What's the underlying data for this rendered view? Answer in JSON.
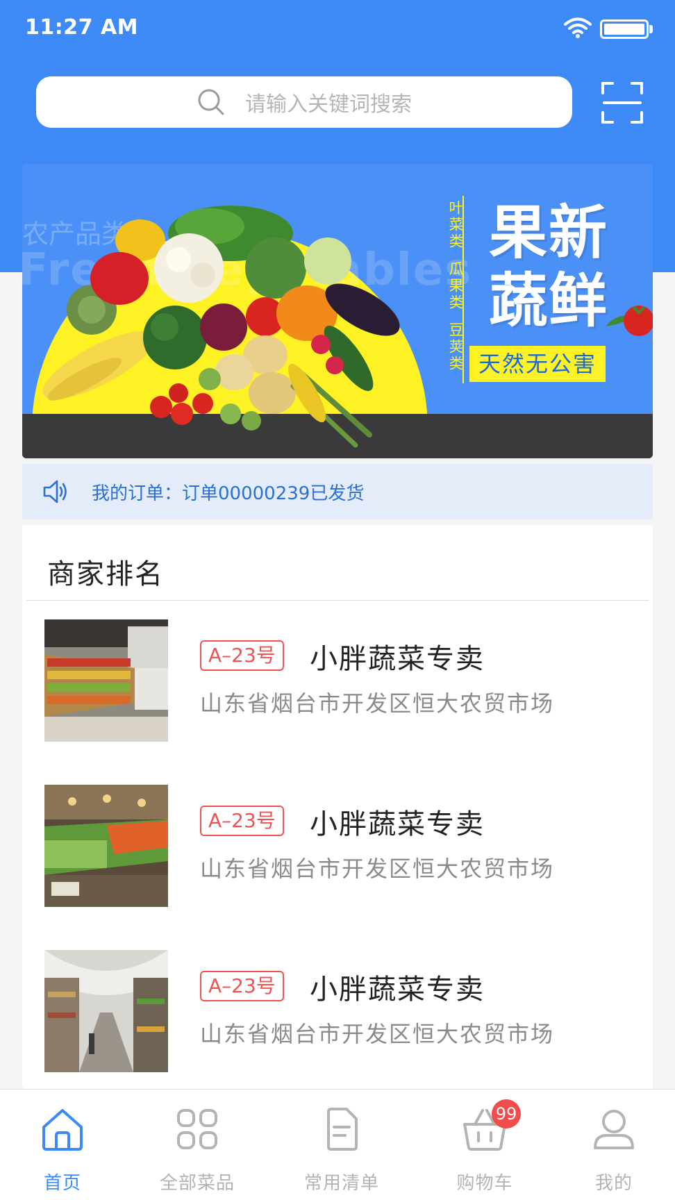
{
  "status_bar": {
    "time": "11:27 AM",
    "battery_level": 1.0
  },
  "search": {
    "placeholder": "请输入关键词搜索",
    "icon": "search-icon",
    "scan_icon": "scan-icon"
  },
  "banner": {
    "ghost_category": "农产品类",
    "ghost_english": "Fresh Vegetables",
    "categories": [
      "叶菜类",
      "瓜果类",
      "豆荚类"
    ],
    "title_line1": "果新",
    "title_line2": "蔬鲜",
    "tag": "天然无公害",
    "colors": {
      "background": "#4b90f6",
      "accent": "#fff224",
      "floor": "#3a3a3a"
    }
  },
  "notice": {
    "icon": "speaker-icon",
    "text": "我的订单：订单00000239已发货"
  },
  "ranking": {
    "title": "商家排名",
    "shops": [
      {
        "tag": "A–23号",
        "name": "小胖蔬菜专卖",
        "address": "山东省烟台市开发区恒大农贸市场"
      },
      {
        "tag": "A–23号",
        "name": "小胖蔬菜专卖",
        "address": "山东省烟台市开发区恒大农贸市场"
      },
      {
        "tag": "A–23号",
        "name": "小胖蔬菜专卖",
        "address": "山东省烟台市开发区恒大农贸市场"
      }
    ]
  },
  "tab_bar": {
    "items": [
      {
        "label": "首页",
        "icon": "home-icon",
        "active": true
      },
      {
        "label": "全部菜品",
        "icon": "grid-icon",
        "active": false
      },
      {
        "label": "常用清单",
        "icon": "document-icon",
        "active": false
      },
      {
        "label": "购物车",
        "icon": "basket-icon",
        "active": false,
        "badge": "99"
      },
      {
        "label": "我的",
        "icon": "user-icon",
        "active": false
      }
    ],
    "colors": {
      "active": "#3d8af7",
      "inactive": "#b3b3b3",
      "badge": "#f24c4c"
    }
  },
  "colors": {
    "primary": "#3d8af7",
    "tag_red": "#f05252"
  }
}
